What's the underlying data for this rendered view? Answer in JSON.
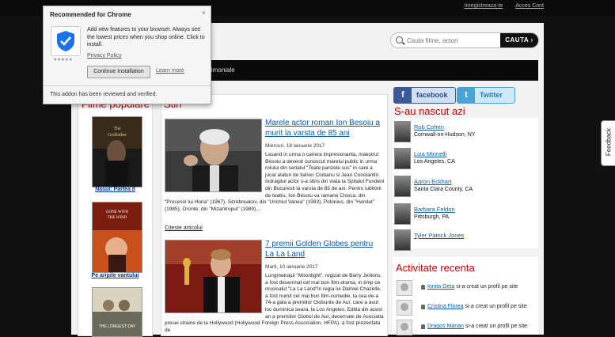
{
  "header": {
    "register_link": "Inregistreaza-te",
    "login_link": "Acces Cont"
  },
  "search": {
    "placeholder": "Cauta filme, actori",
    "button_label": "CAUTA"
  },
  "nav": {
    "visible_item": "trimoniale"
  },
  "popular_films": {
    "heading": "Filme populare",
    "items": [
      {
        "title": "Nasul: Partea II"
      },
      {
        "title": "Pe aripile vantului"
      },
      {
        "title": ""
      }
    ]
  },
  "news": {
    "heading": "Stiri",
    "articles": [
      {
        "title": "Marele actor roman Ion Besoiu a murit la varsta de 85 ani",
        "date": "Miercuri, 18 ianuarie 2017",
        "body": "Lasand in urma o cariera impresionanta, maestrul Besoiu a devenit cunoscut marelui public in urma rolului din serialul \"Toate panzele sus\" in care a jucat alaturi de Ilarion Ciobanu si Jean Constantin. Indragitul actor s-a stins din viata la Spitalul Fundeni din Bucuresti la varsta de 85 de ani. Pentru iubitorii de teatru, Ion Besoiu va ramane Closca, din \"Procesul lui Horia\" (1967), Serebreakov, din \"Unchiul Vanea\" (1983), Polonius, din \"Hamlet\" (1985), Oronte, din \"Mizantropul\" (1989),...",
        "read_more": "Citeste articolul"
      },
      {
        "title": "7 premii Golden Globes pentru La La Land",
        "date": "Marti, 10 ianuarie 2017",
        "body": "Lungmetrajul \"Moonlight\", regizat de Barry Jenkins, a fost desemnat cel mai bun film-drama, in timp ce musicalul \"La La Land\"in regia lui Damiel Chazelle, a fost numit cel mai bun film-comedie, la cea de-a 74-a gala a premiilor Globurile de Aur, care a avut loc duminica seara, la Los Angeles. Editia din acest an a premiilor Globul de Aur, decernate de Asociatia presei straine de la Hollywood (Hollywood Foreign Press Association, HFPA), a fost prezentata de"
      }
    ]
  },
  "social": {
    "facebook_label": "facebook",
    "twitter_label": "Twitter"
  },
  "born_today": {
    "heading": "S-au nascut azi",
    "people": [
      {
        "name": "Rob Cohen",
        "place": "Cornwall-on-Hudson, NY"
      },
      {
        "name": "Liza Minnelli",
        "place": "Los Angeles, CA"
      },
      {
        "name": "Aaron Eckhart",
        "place": "Santa Clara County, CA"
      },
      {
        "name": "Barbara Feldon",
        "place": "Pittsburgh, PA"
      },
      {
        "name": "Tyler Patrick Jones",
        "place": ""
      }
    ]
  },
  "recent_activity": {
    "heading": "Activitate recenta",
    "items": [
      {
        "user": "Ionita Geta",
        "action": "si-a creat un profil pe site"
      },
      {
        "user": "Cristina Florea",
        "action": "si-a creat un profil pe site"
      },
      {
        "user": "Dragos Marian",
        "action": "si-a creat un profil pe site"
      }
    ]
  },
  "feedback_tab": "Feedback",
  "extension_popup": {
    "title": "Recommended for Chrome",
    "description": "Add new features to your browser. Always see the lowest prices when you shop online. Click to install.",
    "privacy_link": "Privacy Policy",
    "install_button": "Continue Installation",
    "learn_more": "Learn more",
    "verified_text": "This addon has been reviewed and verified.",
    "rating_stars": "★★★★★",
    "close_glyph": "×"
  },
  "colors": {
    "accent_red": "#cc0000",
    "link_blue": "#0b5cad",
    "facebook": "#3b5998",
    "twitter": "#4aa3d8"
  }
}
